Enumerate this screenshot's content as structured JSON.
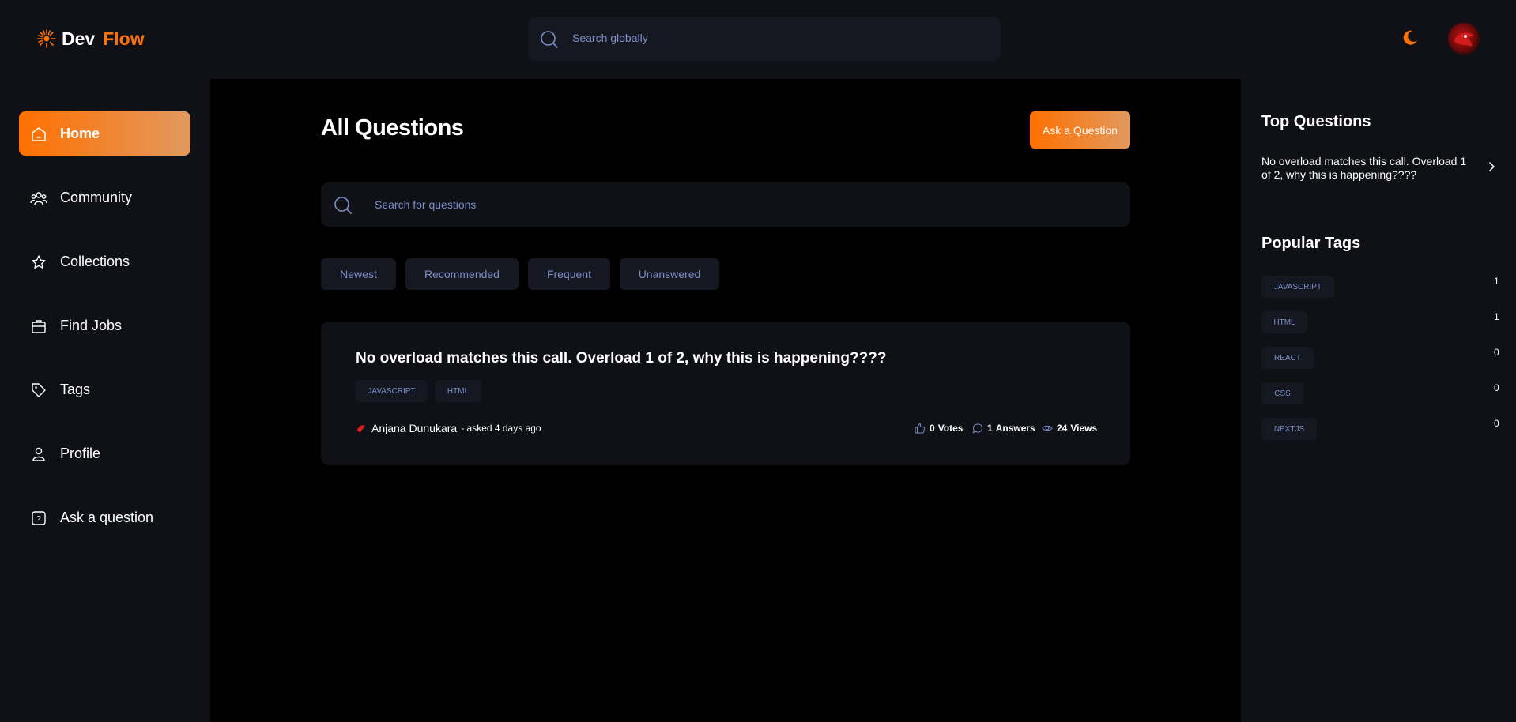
{
  "header": {
    "logo_dev": "Dev",
    "logo_flow": "Flow",
    "search_placeholder": "Search globally"
  },
  "sidebar": {
    "items": [
      {
        "label": "Home",
        "icon": "home-icon",
        "active": true
      },
      {
        "label": "Community",
        "icon": "users-icon"
      },
      {
        "label": "Collections",
        "icon": "star-icon"
      },
      {
        "label": "Find Jobs",
        "icon": "briefcase-icon"
      },
      {
        "label": "Tags",
        "icon": "tag-icon"
      },
      {
        "label": "Profile",
        "icon": "user-icon"
      },
      {
        "label": "Ask a question",
        "icon": "question-icon"
      }
    ]
  },
  "main": {
    "title": "All Questions",
    "ask_button": "Ask a Question",
    "search_placeholder": "Search for questions",
    "filters": [
      "Newest",
      "Recommended",
      "Frequent",
      "Unanswered"
    ],
    "question": {
      "title": "No overload matches this call. Overload 1 of 2, why this is happening????",
      "tags": [
        "JAVASCRIPT",
        "HTML"
      ],
      "author": "Anjana Dunukara",
      "asked": "- asked 4 days ago",
      "votes_value": "0",
      "votes_label": "Votes",
      "answers_value": "1",
      "answers_label": "Answers",
      "views_value": "24",
      "views_label": "Views"
    }
  },
  "right": {
    "top_questions_title": "Top Questions",
    "top_questions": [
      "No overload matches this call. Overload 1 of 2, why this is happening????"
    ],
    "popular_tags_title": "Popular Tags",
    "popular_tags": [
      {
        "name": "JAVASCRIPT",
        "count": "1"
      },
      {
        "name": "HTML",
        "count": "1"
      },
      {
        "name": "REACT",
        "count": "0"
      },
      {
        "name": "CSS",
        "count": "0"
      },
      {
        "name": "NEXTJS",
        "count": "0"
      }
    ]
  },
  "colors": {
    "accent": "#ff7000",
    "accent_end": "#e2995f",
    "panel": "#0f1117",
    "chip": "#151821",
    "muted_text": "#7b8ec8"
  }
}
